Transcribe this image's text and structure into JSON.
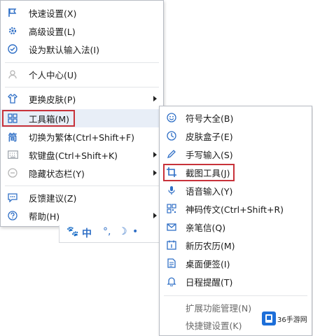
{
  "main_menu": {
    "items": [
      {
        "label": "快速设置(X)",
        "icon": "flag-icon"
      },
      {
        "label": "高级设置(L)",
        "icon": "gear-icon"
      },
      {
        "label": "设为默认输入法(I)",
        "icon": "check-circle-icon"
      },
      {
        "label": "个人中心(U)",
        "icon": "user-icon"
      },
      {
        "label": "更换皮肤(P)",
        "icon": "shirt-icon"
      },
      {
        "label": "工具箱(M)",
        "icon": "grid-icon"
      },
      {
        "label": "切换为繁体(Ctrl+Shift+F)",
        "icon": "traditional-char-icon",
        "icon_text": "简"
      },
      {
        "label": "软键盘(Ctrl+Shift+K)",
        "icon": "keyboard-icon"
      },
      {
        "label": "隐藏状态栏(Y)",
        "icon": "minus-circle-icon"
      },
      {
        "label": "反馈建议(Z)",
        "icon": "chat-icon"
      },
      {
        "label": "帮助(H)",
        "icon": "help-icon"
      }
    ]
  },
  "toolbox_submenu": {
    "items": [
      {
        "label": "符号大全(B)",
        "icon": "smiley-icon"
      },
      {
        "label": "皮肤盒子(E)",
        "icon": "skin-box-icon"
      },
      {
        "label": "手写输入(S)",
        "icon": "pen-icon"
      },
      {
        "label": "截图工具(J)",
        "icon": "crop-icon"
      },
      {
        "label": "语音输入(Y)",
        "icon": "mic-icon"
      },
      {
        "label": "神码传文(Ctrl+Shift+R)",
        "icon": "qr-icon"
      },
      {
        "label": "亲笔信(Q)",
        "icon": "mail-icon"
      },
      {
        "label": "新历农历(M)",
        "icon": "calendar-icon"
      },
      {
        "label": "桌面便签(I)",
        "icon": "note-icon"
      },
      {
        "label": "日程提醒(T)",
        "icon": "bell-icon"
      },
      {
        "label": "扩展功能管理(N)"
      },
      {
        "label": "快捷键设置(K)"
      }
    ]
  },
  "watermark": {
    "text": "36手游网"
  },
  "colors": {
    "highlight_border": "#c8323a",
    "icon_blue": "#2f6fc6",
    "active_bg": "#e8eef7"
  }
}
